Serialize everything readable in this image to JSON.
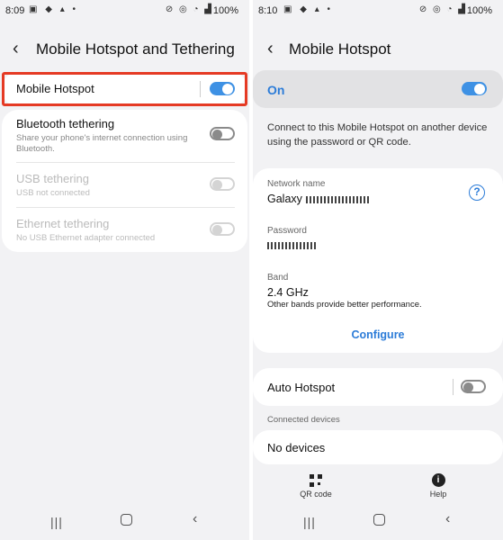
{
  "left": {
    "status": {
      "time": "8:09",
      "battery": "100%"
    },
    "title": "Mobile Hotspot and Tethering",
    "items": [
      {
        "label": "Mobile Hotspot",
        "sub": ""
      },
      {
        "label": "Bluetooth tethering",
        "sub": "Share your phone's internet connection using Bluetooth."
      },
      {
        "label": "USB tethering",
        "sub": "USB not connected"
      },
      {
        "label": "Ethernet tethering",
        "sub": "No USB Ethernet adapter connected"
      }
    ]
  },
  "right": {
    "status": {
      "time": "8:10",
      "battery": "100%"
    },
    "title": "Mobile Hotspot",
    "on_label": "On",
    "description": "Connect to this Mobile Hotspot on another device using the password or QR code.",
    "network_name_label": "Network name",
    "network_name_value": "Galaxy",
    "password_label": "Password",
    "band_label": "Band",
    "band_value": "2.4 GHz",
    "band_note": "Other bands provide better performance.",
    "configure": "Configure",
    "auto_hotspot": "Auto Hotspot",
    "connected_devices": "Connected devices",
    "no_devices": "No devices",
    "qr_code": "QR code",
    "help": "Help"
  },
  "colors": {
    "accent": "#3e91e4",
    "highlight": "#e53a24"
  }
}
